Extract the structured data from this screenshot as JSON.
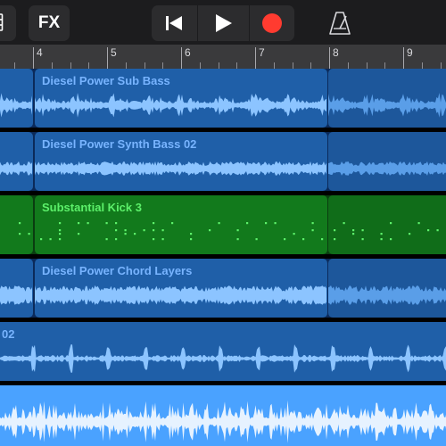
{
  "toolbar": {
    "fx_label": "FX",
    "icons": [
      "tracks-view-icon",
      "rewind-icon",
      "play-icon",
      "record-icon",
      "metronome-icon"
    ],
    "colors": {
      "background": "#1c1c1e",
      "button": "#2c2c2e",
      "record": "#ff3b30"
    }
  },
  "ruler": {
    "bars": [
      "4",
      "5",
      "6",
      "7",
      "8",
      "9"
    ]
  },
  "tracks": [
    {
      "region_name": "Diesel Power Sub Bass",
      "type": "audio",
      "color": "#1f5fa8",
      "label_color": "#78b4ff"
    },
    {
      "region_name": "Diesel Power Synth Bass 02",
      "type": "audio",
      "color": "#1f5fa8",
      "label_color": "#78b4ff"
    },
    {
      "region_name": "Substantial Kick 3",
      "type": "midi",
      "color": "#127a1c",
      "label_color": "#5cf06a"
    },
    {
      "region_name": "Diesel Power Chord Layers",
      "type": "audio",
      "color": "#1f5fa8",
      "label_color": "#78b4ff"
    },
    {
      "region_name": "02",
      "type": "audio",
      "color": "#1f5fa8",
      "label_color": "#78b4ff"
    },
    {
      "region_name": "",
      "type": "audio",
      "color": "#4aa2ff",
      "label_color": "#ffffff",
      "selected": true
    }
  ]
}
